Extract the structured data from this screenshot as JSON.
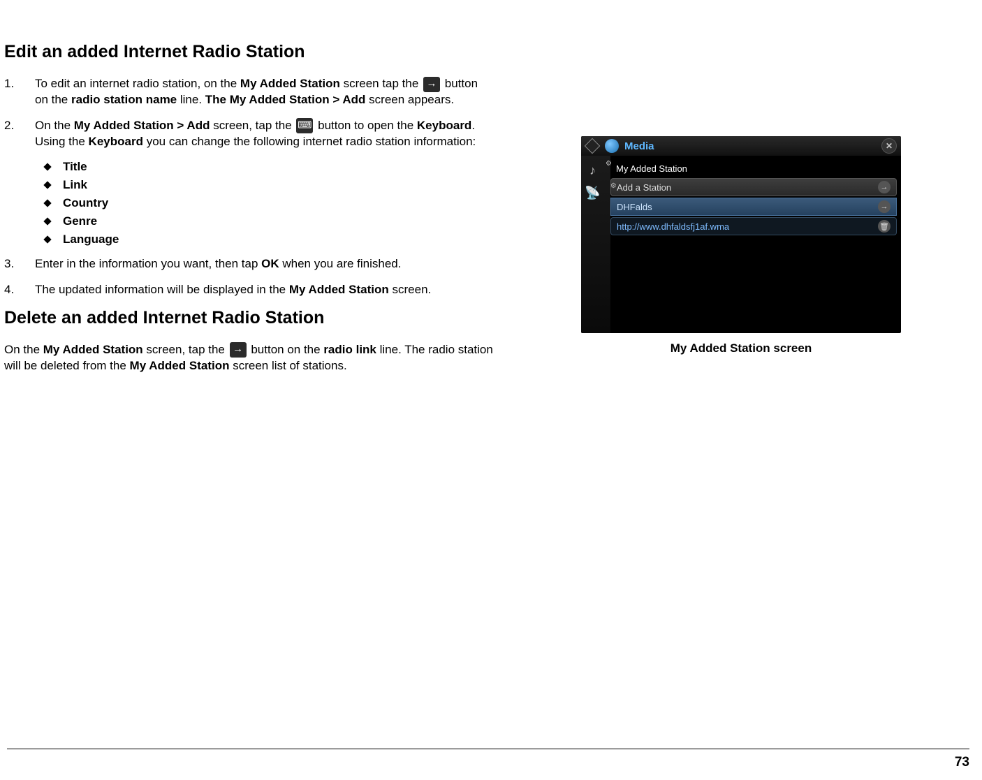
{
  "section1": {
    "heading": "Edit an added Internet Radio Station",
    "step1": {
      "num": "1.",
      "t1": "To edit an internet radio station, on the ",
      "b1": "My Added Station",
      "t2": " screen tap the ",
      "t3": " button on the ",
      "b2": "radio station name",
      "t4": " line.  ",
      "b3": "The My Added Station > Add",
      "t5": " screen appears."
    },
    "step2": {
      "num": "2.",
      "t1": "On the ",
      "b1": "My Added Station > Add",
      "t2": " screen, tap the ",
      "t3": " button to open the ",
      "b2": "Keyboard",
      "t4": ".  Using the ",
      "b3": "Keyboard",
      "t5": " you can change the following internet radio station information:"
    },
    "fields": [
      "Title",
      "Link",
      "Country",
      "Genre",
      "Language"
    ],
    "step3": {
      "num": "3.",
      "t1": "Enter in the information you want, then tap ",
      "b1": "OK",
      "t2": " when you are finished."
    },
    "step4": {
      "num": "4.",
      "t1": "The updated information will be displayed in the ",
      "b1": "My Added Station",
      "t2": " screen."
    }
  },
  "section2": {
    "heading": "Delete an added Internet Radio Station",
    "para": {
      "t1": "On the ",
      "b1": "My Added Station",
      "t2": " screen, tap the ",
      "t3": " button on the ",
      "b2": "radio link",
      "t4": " line.  The radio station will be deleted from the ",
      "b3": "My Added Station",
      "t5": " screen list of stations."
    }
  },
  "screenshot": {
    "title": "Media",
    "rows": {
      "header": "My Added Station",
      "add": "Add a Station",
      "station": "DHFalds",
      "link": "http://www.dhfaldsfj1af.wma"
    },
    "caption": "My Added Station screen"
  },
  "pageNumber": "73"
}
